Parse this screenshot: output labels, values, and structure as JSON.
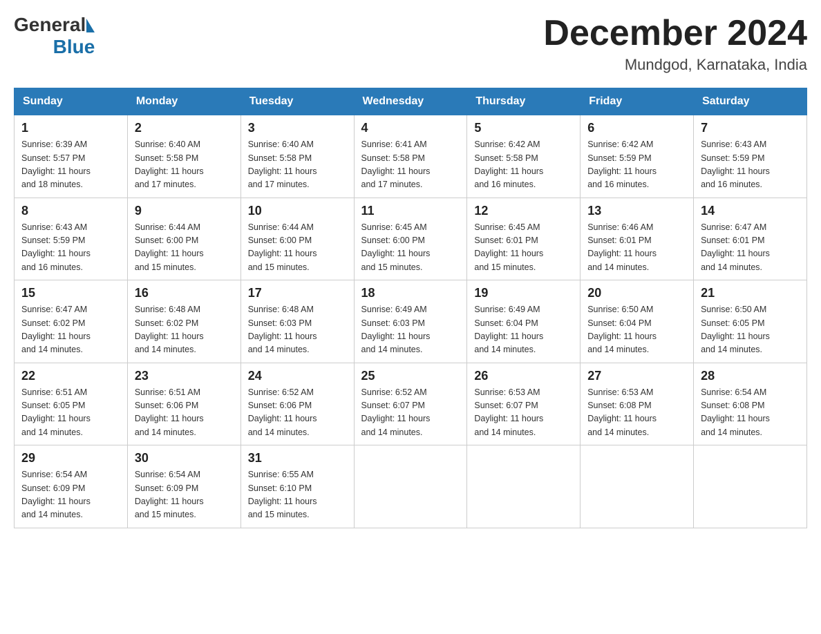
{
  "header": {
    "logo_general": "General",
    "logo_blue": "Blue",
    "title": "December 2024",
    "location": "Mundgod, Karnataka, India"
  },
  "days_of_week": [
    "Sunday",
    "Monday",
    "Tuesday",
    "Wednesday",
    "Thursday",
    "Friday",
    "Saturday"
  ],
  "weeks": [
    [
      {
        "day": "1",
        "sunrise": "6:39 AM",
        "sunset": "5:57 PM",
        "daylight": "11 hours and 18 minutes."
      },
      {
        "day": "2",
        "sunrise": "6:40 AM",
        "sunset": "5:58 PM",
        "daylight": "11 hours and 17 minutes."
      },
      {
        "day": "3",
        "sunrise": "6:40 AM",
        "sunset": "5:58 PM",
        "daylight": "11 hours and 17 minutes."
      },
      {
        "day": "4",
        "sunrise": "6:41 AM",
        "sunset": "5:58 PM",
        "daylight": "11 hours and 17 minutes."
      },
      {
        "day": "5",
        "sunrise": "6:42 AM",
        "sunset": "5:58 PM",
        "daylight": "11 hours and 16 minutes."
      },
      {
        "day": "6",
        "sunrise": "6:42 AM",
        "sunset": "5:59 PM",
        "daylight": "11 hours and 16 minutes."
      },
      {
        "day": "7",
        "sunrise": "6:43 AM",
        "sunset": "5:59 PM",
        "daylight": "11 hours and 16 minutes."
      }
    ],
    [
      {
        "day": "8",
        "sunrise": "6:43 AM",
        "sunset": "5:59 PM",
        "daylight": "11 hours and 16 minutes."
      },
      {
        "day": "9",
        "sunrise": "6:44 AM",
        "sunset": "6:00 PM",
        "daylight": "11 hours and 15 minutes."
      },
      {
        "day": "10",
        "sunrise": "6:44 AM",
        "sunset": "6:00 PM",
        "daylight": "11 hours and 15 minutes."
      },
      {
        "day": "11",
        "sunrise": "6:45 AM",
        "sunset": "6:00 PM",
        "daylight": "11 hours and 15 minutes."
      },
      {
        "day": "12",
        "sunrise": "6:45 AM",
        "sunset": "6:01 PM",
        "daylight": "11 hours and 15 minutes."
      },
      {
        "day": "13",
        "sunrise": "6:46 AM",
        "sunset": "6:01 PM",
        "daylight": "11 hours and 14 minutes."
      },
      {
        "day": "14",
        "sunrise": "6:47 AM",
        "sunset": "6:01 PM",
        "daylight": "11 hours and 14 minutes."
      }
    ],
    [
      {
        "day": "15",
        "sunrise": "6:47 AM",
        "sunset": "6:02 PM",
        "daylight": "11 hours and 14 minutes."
      },
      {
        "day": "16",
        "sunrise": "6:48 AM",
        "sunset": "6:02 PM",
        "daylight": "11 hours and 14 minutes."
      },
      {
        "day": "17",
        "sunrise": "6:48 AM",
        "sunset": "6:03 PM",
        "daylight": "11 hours and 14 minutes."
      },
      {
        "day": "18",
        "sunrise": "6:49 AM",
        "sunset": "6:03 PM",
        "daylight": "11 hours and 14 minutes."
      },
      {
        "day": "19",
        "sunrise": "6:49 AM",
        "sunset": "6:04 PM",
        "daylight": "11 hours and 14 minutes."
      },
      {
        "day": "20",
        "sunrise": "6:50 AM",
        "sunset": "6:04 PM",
        "daylight": "11 hours and 14 minutes."
      },
      {
        "day": "21",
        "sunrise": "6:50 AM",
        "sunset": "6:05 PM",
        "daylight": "11 hours and 14 minutes."
      }
    ],
    [
      {
        "day": "22",
        "sunrise": "6:51 AM",
        "sunset": "6:05 PM",
        "daylight": "11 hours and 14 minutes."
      },
      {
        "day": "23",
        "sunrise": "6:51 AM",
        "sunset": "6:06 PM",
        "daylight": "11 hours and 14 minutes."
      },
      {
        "day": "24",
        "sunrise": "6:52 AM",
        "sunset": "6:06 PM",
        "daylight": "11 hours and 14 minutes."
      },
      {
        "day": "25",
        "sunrise": "6:52 AM",
        "sunset": "6:07 PM",
        "daylight": "11 hours and 14 minutes."
      },
      {
        "day": "26",
        "sunrise": "6:53 AM",
        "sunset": "6:07 PM",
        "daylight": "11 hours and 14 minutes."
      },
      {
        "day": "27",
        "sunrise": "6:53 AM",
        "sunset": "6:08 PM",
        "daylight": "11 hours and 14 minutes."
      },
      {
        "day": "28",
        "sunrise": "6:54 AM",
        "sunset": "6:08 PM",
        "daylight": "11 hours and 14 minutes."
      }
    ],
    [
      {
        "day": "29",
        "sunrise": "6:54 AM",
        "sunset": "6:09 PM",
        "daylight": "11 hours and 14 minutes."
      },
      {
        "day": "30",
        "sunrise": "6:54 AM",
        "sunset": "6:09 PM",
        "daylight": "11 hours and 15 minutes."
      },
      {
        "day": "31",
        "sunrise": "6:55 AM",
        "sunset": "6:10 PM",
        "daylight": "11 hours and 15 minutes."
      },
      null,
      null,
      null,
      null
    ]
  ],
  "labels": {
    "sunrise": "Sunrise:",
    "sunset": "Sunset:",
    "daylight": "Daylight:"
  }
}
